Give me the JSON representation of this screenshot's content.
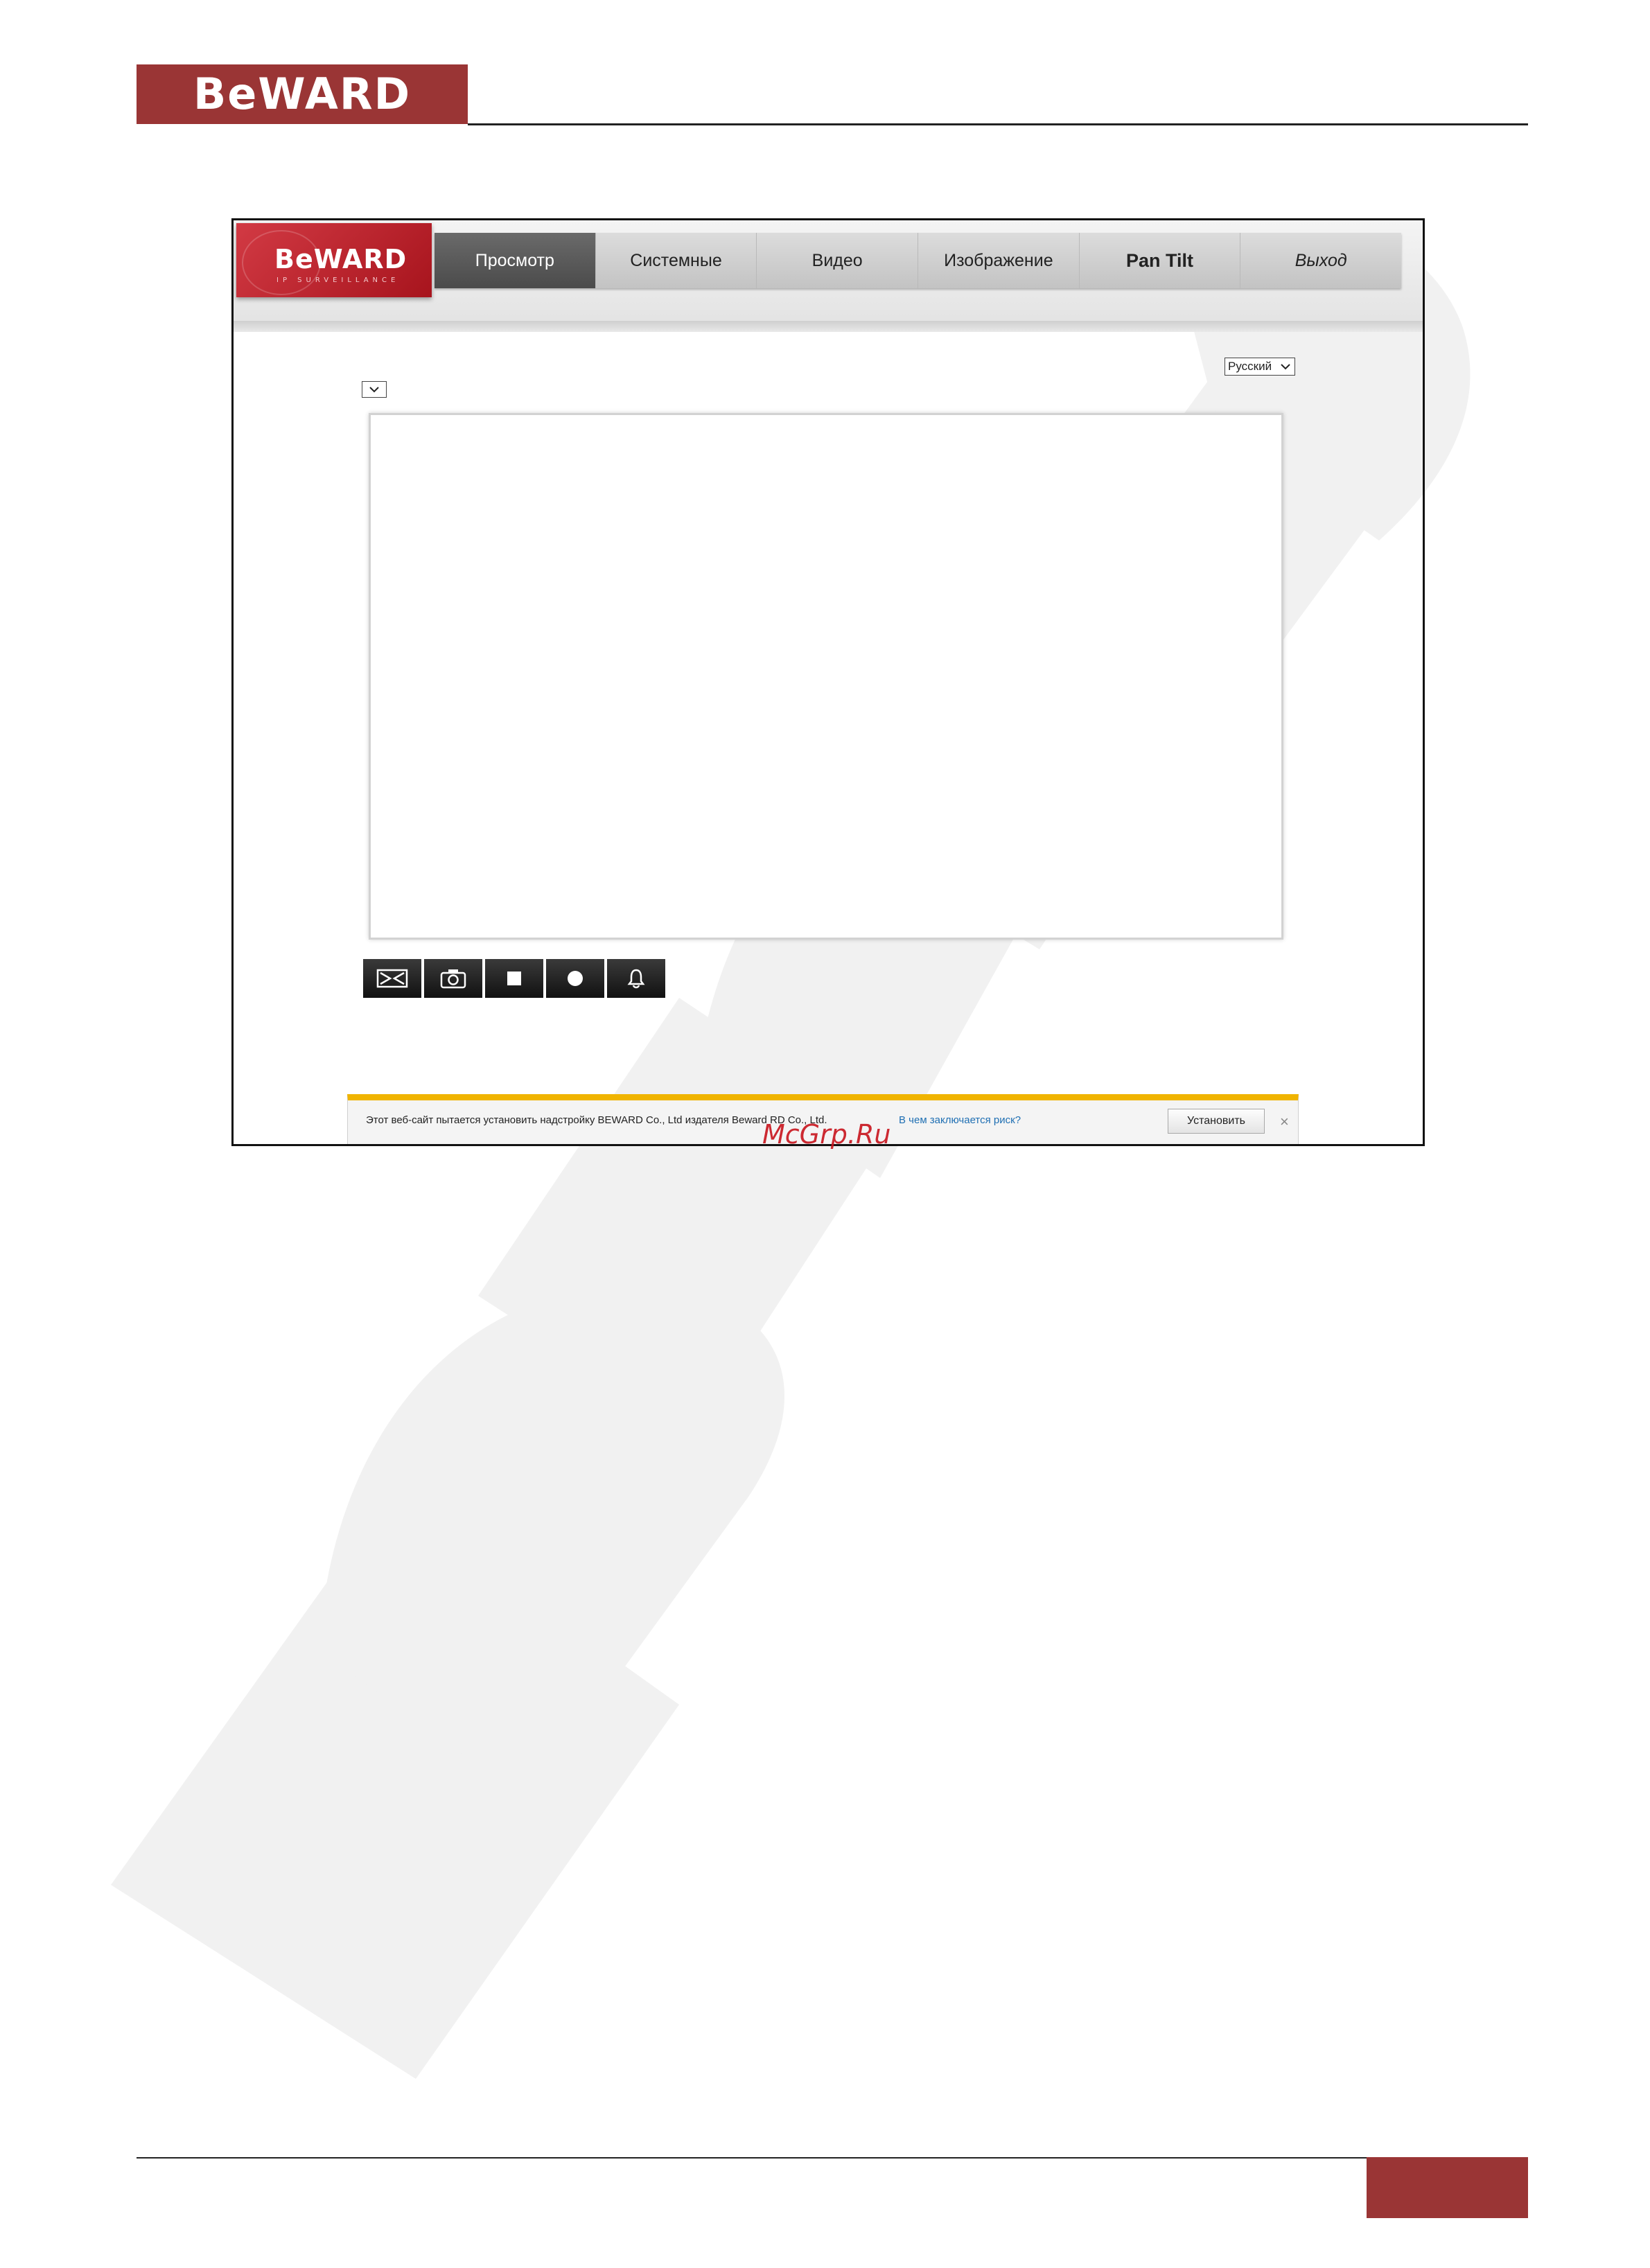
{
  "brand": {
    "name": "BeWARD",
    "color": "#9a3535"
  },
  "app": {
    "logo_name": "BeWARD",
    "logo_sub": "IP SURVEILLANCE",
    "nav": [
      {
        "label": "Просмотр",
        "active": true
      },
      {
        "label": "Системные"
      },
      {
        "label": "Видео"
      },
      {
        "label": "Изображение"
      },
      {
        "label": "Pan Tilt"
      },
      {
        "label": "Выход"
      }
    ],
    "language_selected": "Русский",
    "toolbar_icons": [
      "fullscreen-icon",
      "snapshot-camera-icon",
      "stop-icon",
      "record-icon",
      "alarm-bell-icon"
    ]
  },
  "infobar": {
    "message": "Этот веб-сайт пытается установить надстройку BEWARD Co., Ltd издателя Beward RD Co., Ltd.",
    "risk_link": "В чем заключается риск?",
    "install_button": "Установить",
    "close": "×"
  },
  "site_watermark": "McGrp.Ru"
}
